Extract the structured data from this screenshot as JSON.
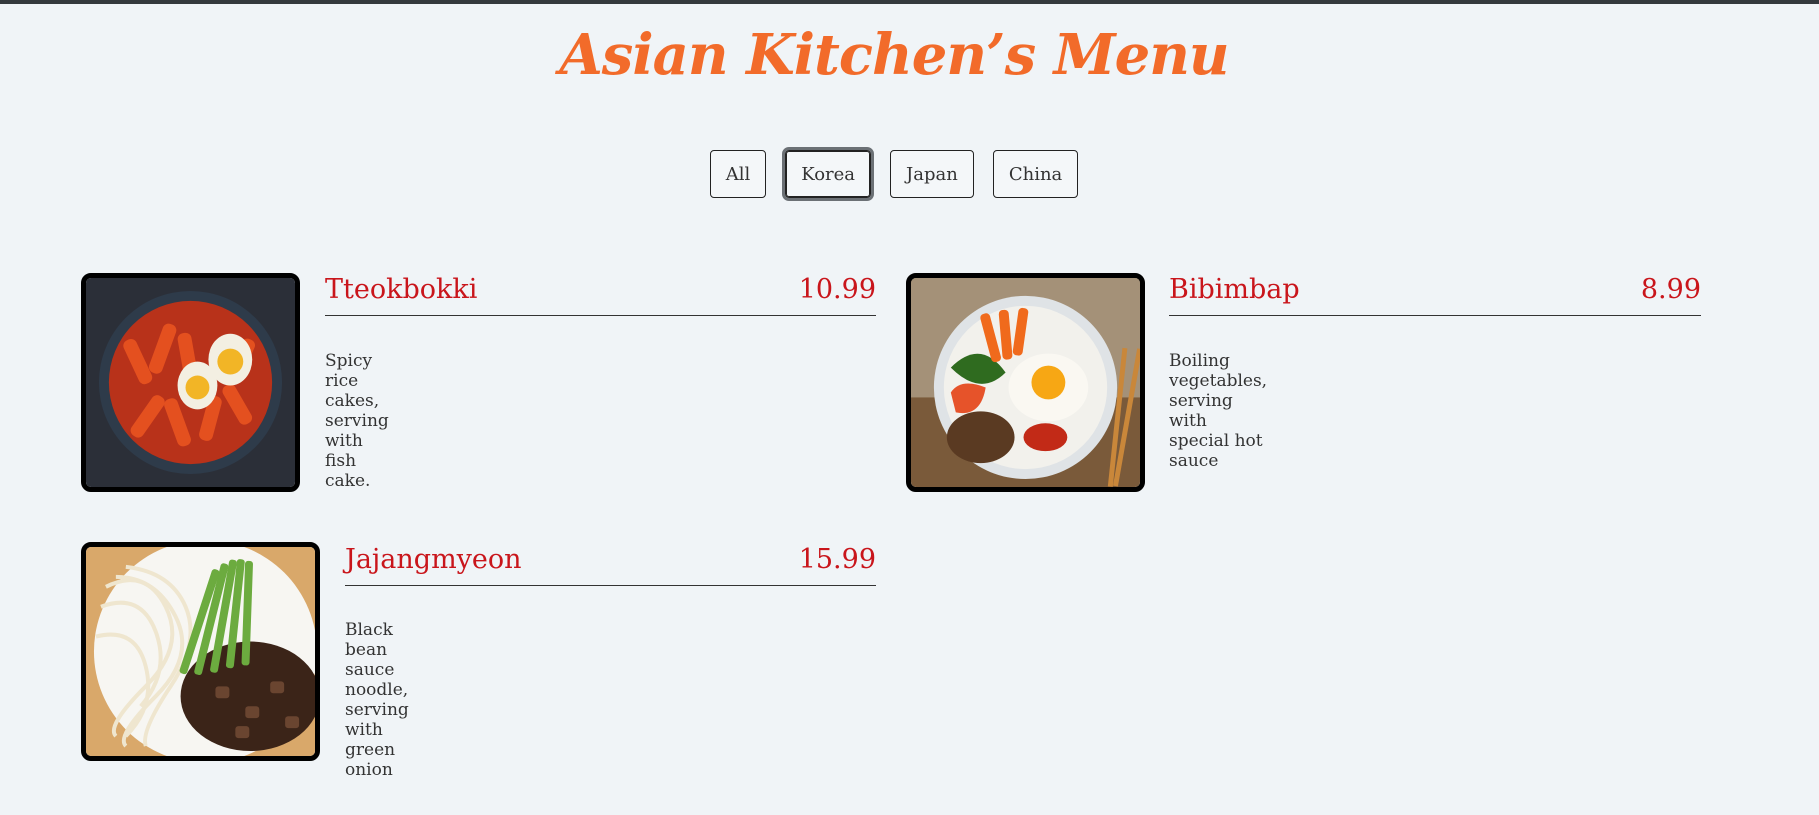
{
  "header": {
    "title": "Asian Kitchen’s Menu"
  },
  "filters": [
    {
      "label": "All"
    },
    {
      "label": "Korea"
    },
    {
      "label": "Japan"
    },
    {
      "label": "China"
    }
  ],
  "active_filter": "Korea",
  "menu": [
    {
      "name": "Tteokbokki",
      "price": "10.99",
      "description": "Spicy rice cakes, serving with fish cake."
    },
    {
      "name": "Bibimbap",
      "price": "8.99",
      "description": "Boiling vegetables, serving with special hot sauce"
    },
    {
      "name": "Jajangmyeon",
      "price": "15.99",
      "description": "Black bean sauce noodle, serving with green onion"
    }
  ],
  "colors": {
    "accent": "#f26b2a",
    "price": "#c9151b",
    "background": "#f0f4f7"
  }
}
